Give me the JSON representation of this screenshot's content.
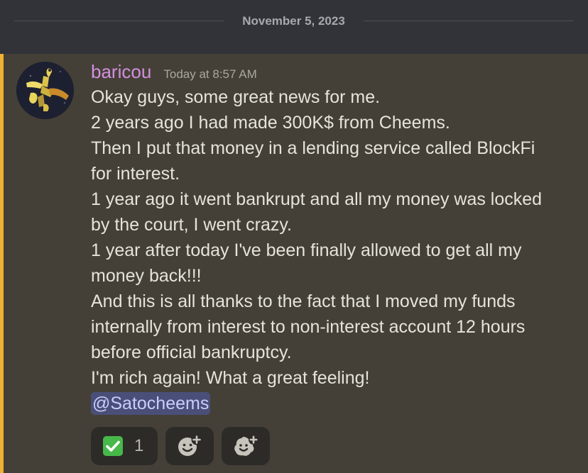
{
  "date_divider": {
    "label": "November 5, 2023"
  },
  "message": {
    "author": "baricou",
    "timestamp": "Today at 8:57 AM",
    "author_color": "#d48ee0",
    "highlight_color": "#f0b232",
    "lines": [
      "Okay guys, some great news for me.",
      "2 years ago I had made 300K$ from Cheems.",
      "Then I put that money in a lending service called BlockFi",
      "for interest.",
      "1 year ago it went bankrupt and all my money was locked",
      "by the court, I went crazy.",
      "1 year after today I've been finally allowed to get all my",
      "money back!!!",
      "And this is all thanks to the fact that I moved my funds",
      "internally from interest to non-interest account 12 hours",
      "before official bankruptcy.",
      "I'm rich again! What a great feeling!"
    ],
    "mention": "@Satocheems"
  },
  "reactions": [
    {
      "emoji": "white-check-mark",
      "count": "1"
    },
    {
      "icon": "add-reaction-icon"
    },
    {
      "icon": "add-super-reaction-icon"
    }
  ]
}
